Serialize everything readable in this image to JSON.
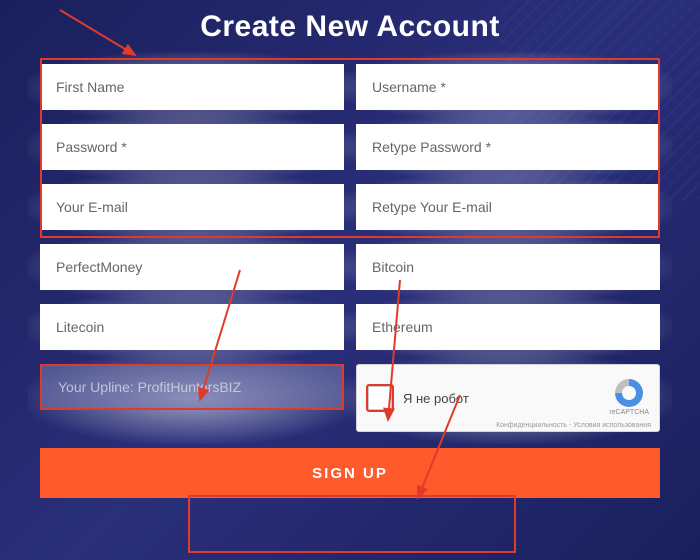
{
  "title": "Create New Account",
  "fields": {
    "first_name": {
      "placeholder": "First Name"
    },
    "username": {
      "placeholder": "Username *"
    },
    "password": {
      "placeholder": "Password *"
    },
    "retype_password": {
      "placeholder": "Retype Password *"
    },
    "email": {
      "placeholder": "Your E-mail"
    },
    "retype_email": {
      "placeholder": "Retype Your E-mail"
    },
    "perfectmoney": {
      "placeholder": "PerfectMoney"
    },
    "bitcoin": {
      "placeholder": "Bitcoin"
    },
    "litecoin": {
      "placeholder": "Litecoin"
    },
    "ethereum": {
      "placeholder": "Ethereum"
    }
  },
  "upline": {
    "label": "Your Upline: ProfitHuntersBIZ"
  },
  "recaptcha": {
    "label": "Я не робот",
    "brand": "reCAPTCHA",
    "privacy": "Конфиденциальность - Условия использования"
  },
  "submit": {
    "label": "SIGN UP"
  }
}
